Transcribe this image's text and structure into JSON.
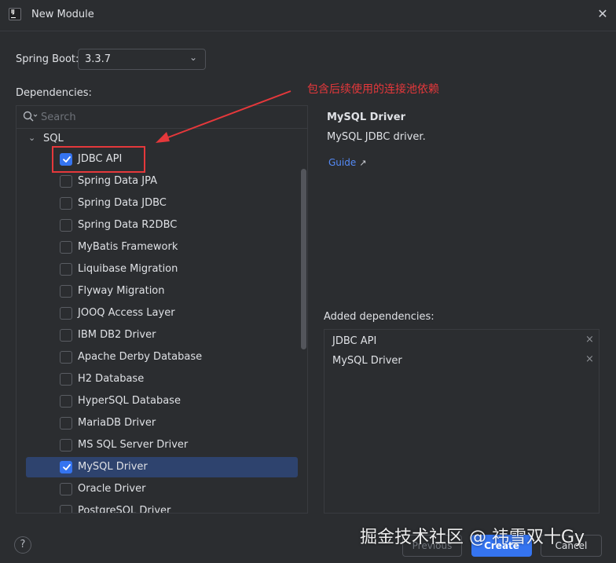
{
  "window": {
    "title": "New Module",
    "app_icon": "intellij-icon",
    "close_icon": "close-icon"
  },
  "spring_boot": {
    "label": "Spring Boot:",
    "value": "3.3.7"
  },
  "dependencies": {
    "label": "Dependencies:",
    "search_placeholder": "Search",
    "category": "SQL",
    "items": [
      {
        "label": "JDBC API",
        "checked": true,
        "selected": false
      },
      {
        "label": "Spring Data JPA",
        "checked": false,
        "selected": false
      },
      {
        "label": "Spring Data JDBC",
        "checked": false,
        "selected": false
      },
      {
        "label": "Spring Data R2DBC",
        "checked": false,
        "selected": false
      },
      {
        "label": "MyBatis Framework",
        "checked": false,
        "selected": false
      },
      {
        "label": "Liquibase Migration",
        "checked": false,
        "selected": false
      },
      {
        "label": "Flyway Migration",
        "checked": false,
        "selected": false
      },
      {
        "label": "JOOQ Access Layer",
        "checked": false,
        "selected": false
      },
      {
        "label": "IBM DB2 Driver",
        "checked": false,
        "selected": false
      },
      {
        "label": "Apache Derby Database",
        "checked": false,
        "selected": false
      },
      {
        "label": "H2 Database",
        "checked": false,
        "selected": false
      },
      {
        "label": "HyperSQL Database",
        "checked": false,
        "selected": false
      },
      {
        "label": "MariaDB Driver",
        "checked": false,
        "selected": false
      },
      {
        "label": "MS SQL Server Driver",
        "checked": false,
        "selected": false
      },
      {
        "label": "MySQL Driver",
        "checked": true,
        "selected": true
      },
      {
        "label": "Oracle Driver",
        "checked": false,
        "selected": false
      },
      {
        "label": "PostgreSQL Driver",
        "checked": false,
        "selected": false
      }
    ]
  },
  "annotation": {
    "text": "包含后续使用的连接池依赖",
    "color": "#e5383b"
  },
  "detail": {
    "title": "MySQL Driver",
    "description": "MySQL JDBC driver.",
    "guide_label": "Guide",
    "guide_arrow": "↗"
  },
  "added": {
    "label": "Added dependencies:",
    "items": [
      {
        "label": "JDBC API"
      },
      {
        "label": "MySQL Driver"
      }
    ],
    "remove_glyph": "×"
  },
  "footer": {
    "help_label": "?",
    "previous_label": "Previous",
    "create_label": "Create",
    "cancel_label": "Cancel"
  },
  "watermark": "掘金技术社区 @ 祎雪双十Gy",
  "colors": {
    "accent": "#3574f0",
    "background": "#2b2d30",
    "selection": "#2e436e"
  }
}
